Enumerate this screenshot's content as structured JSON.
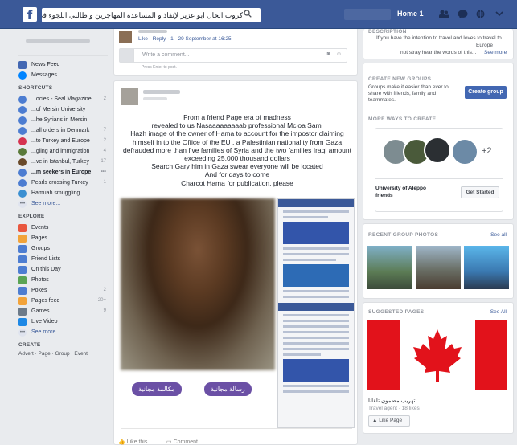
{
  "topbar": {
    "search_text": "كروب الحال ابو عزيز لإنقاذ و المساعدة المهاجرين و طالبي اللجوء في أوروبا",
    "home_label": "Home 1"
  },
  "sidebar": {
    "top_items": [
      {
        "label": "News Feed"
      },
      {
        "label": "Messages"
      }
    ],
    "shortcuts_heading": "SHORTCUTS",
    "shortcuts": [
      {
        "label": "...ocies - Seal Magazine",
        "count": "2"
      },
      {
        "label": "...of Mersin University",
        "count": ""
      },
      {
        "label": "...he Syrians in Mersin",
        "count": ""
      },
      {
        "label": "...all orders in Denmark",
        "count": "7"
      },
      {
        "label": "...to Turkey and Europe",
        "count": "2"
      },
      {
        "label": "...gling and immigration",
        "count": "4"
      },
      {
        "label": "...ve in Istanbul, Turkey",
        "count": "17"
      },
      {
        "label": "...m seekers in Europe",
        "count": "•••"
      },
      {
        "label": "Pearls crossing Turkey",
        "count": "1"
      },
      {
        "label": "Hamuah smuggling",
        "count": ""
      }
    ],
    "see_more_1": "See more...",
    "explore_heading": "EXPLORE",
    "explore": [
      {
        "label": "Events",
        "count": ""
      },
      {
        "label": "Pages",
        "count": ""
      },
      {
        "label": "Groups",
        "count": ""
      },
      {
        "label": "Friend Lists",
        "count": ""
      },
      {
        "label": "On this Day",
        "count": ""
      },
      {
        "label": "Photos",
        "count": ""
      },
      {
        "label": "Pokes",
        "count": "2"
      },
      {
        "label": "Pages feed",
        "count": "20+"
      },
      {
        "label": "Games",
        "count": "9"
      },
      {
        "label": "Live Video",
        "count": ""
      }
    ],
    "see_more_2": "See more...",
    "create_heading": "CREATE",
    "create_links": "Advert · Page · Group · Event"
  },
  "feed": {
    "comment_meta": "Like · Reply · 1 · 29 September at 16:25",
    "write_placeholder": "Write a comment...",
    "press_enter": "Press Enter to post.",
    "post_text": [
      "From a friend Page era of madness",
      "revealed to us Nasaaaaaaaaab professional Mcioa Sami",
      "Hazh image of the owner of Hama to account for the impostor claiming",
      "himself in to the Office of the EU , a Palestinian nationality from Gaza",
      "defrauded more than five families of Syria and the two families Iraqi amount",
      "exceeding 25,000 thousand dollars",
      "Search Gary him in Gaza swear everyone will be located",
      "And for days to come",
      "Charcot Hama for publication, please"
    ],
    "btn_free_call": "مكالمة مجانية",
    "btn_free_message": "رسالة مجانية",
    "like_label": "Like this",
    "comment_label": "Comment"
  },
  "right": {
    "description_heading": "DESCRIPTION",
    "description_text_1": "If you have the intention to travel and loves to travel to",
    "description_text_2": "Europe",
    "description_text_3": "not stray hear the words of this...",
    "see_more": "See more",
    "create_heading": "CREATE NEW GROUPS",
    "create_text": "Groups make it easier than ever to share with friends, family and teammates.",
    "create_button": "Create group",
    "ways_heading": "MORE WAYS TO CREATE",
    "plus_count": "+2",
    "suggest_name": "University of Aleppo friends",
    "get_started": "Get Started",
    "recent_heading": "RECENT GROUP PHOTOS",
    "see_all_1": "See all",
    "suggested_heading": "SUGGESTED PAGES",
    "see_all_2": "See All",
    "page_name": "تهريب مضمون تلقانا",
    "page_meta": "Travel agent · 18 likes",
    "like_page": "Like Page",
    "flag_red": "#e2121b"
  }
}
